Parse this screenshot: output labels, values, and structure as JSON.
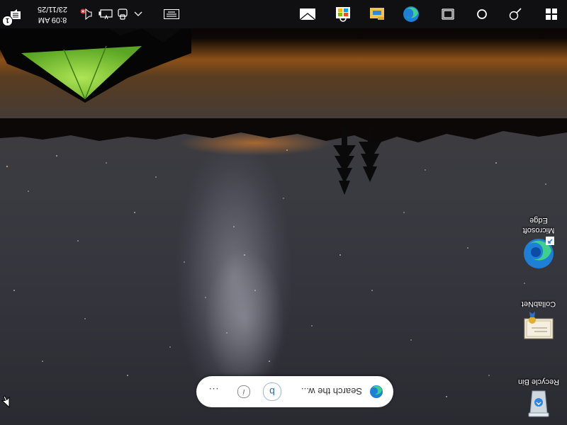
{
  "desktop": {
    "icons": [
      {
        "label": "Recycle Bin",
        "icon": "recycle-bin-icon"
      },
      {
        "label": "CollabNet",
        "icon": "certificate-icon"
      },
      {
        "label": "Microsoft Edge",
        "icon": "edge-icon"
      }
    ]
  },
  "search_widget": {
    "placeholder": "Search the w...",
    "bing_icon": "b",
    "info_icon": "i",
    "more_label": "..."
  },
  "taskbar": {
    "start_icon": "windows-start-icon",
    "search_icon": "search-icon",
    "cortana_icon": "cortana-icon",
    "taskview_icon": "task-view-icon",
    "apps": [
      "edge-icon",
      "file-explorer-icon",
      "microsoft-store-icon",
      "mail-icon"
    ]
  },
  "tray": {
    "keyboard_icon": "touch-keyboard-icon",
    "chevron_icon": "chevron-up-icon",
    "icons": [
      "meet-now-icon",
      "battery-icon",
      "volume-muted-icon"
    ],
    "time": "8:09 AM",
    "date": "23/11/25",
    "notification_count": "1"
  },
  "colors": {
    "taskbar": "#101013",
    "accent": "#0078d4",
    "tent_green": "#7fd43a"
  }
}
